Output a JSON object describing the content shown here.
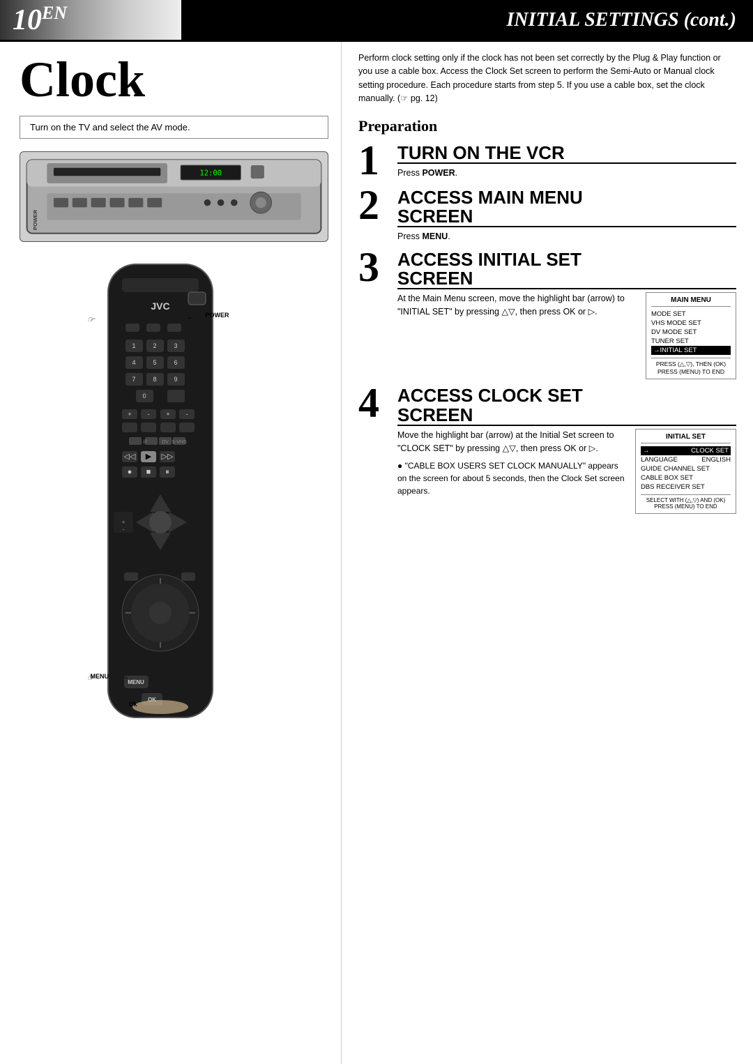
{
  "header": {
    "page_number": "10",
    "en_suffix": "EN",
    "title": "INITIAL SETTINGS (cont.)"
  },
  "left": {
    "section_title": "Clock",
    "tv_instruction": "Turn on the TV and select the AV mode.",
    "power_label": "POWER",
    "menu_label": "MENU",
    "ok_label": "Ok"
  },
  "right": {
    "intro": "Perform clock setting only if the clock has not been set correctly by the Plug & Play function or you use a cable box. Access the Clock Set screen to perform the Semi-Auto or Manual clock setting procedure. Each procedure starts from step 5. If you use a cable box, set the clock manually. (☞ pg. 12)",
    "preparation_title": "Preparation",
    "steps": [
      {
        "number": "1",
        "heading": "TURN ON THE VCR",
        "description": "Press ",
        "bold": "POWER",
        "description_after": "."
      },
      {
        "number": "2",
        "heading_line1": "ACCESS MAIN MENU",
        "heading_line2": "SCREEN",
        "description": "Press ",
        "bold": "MENU",
        "description_after": "."
      },
      {
        "number": "3",
        "heading_line1": "ACCESS INITIAL SET",
        "heading_line2": "SCREEN",
        "description": "At the Main Menu screen, move the highlight bar (arrow) to \"INITIAL SET\" by pressing △▽, then press OK or ▷."
      },
      {
        "number": "4",
        "heading_line1": "ACCESS CLOCK SET",
        "heading_line2": "SCREEN",
        "description": "Move the highlight bar (arrow) at the Initial Set screen to \"CLOCK SET\" by pressing △▽, then press OK or ▷.",
        "bullet": "\"CABLE BOX USERS SET CLOCK MANUALLY\" appears on the screen for about 5 seconds, then the Clock Set screen appears."
      }
    ],
    "main_menu_box": {
      "title": "MAIN MENU",
      "items": [
        "MODE SET",
        "VHS MODE SET",
        "DV MODE SET",
        "TUNER SET",
        "INITIAL SET"
      ],
      "highlighted_item": "INITIAL SET",
      "footer_line1": "PRESS (△,▽), THEN (OK)",
      "footer_line2": "PRESS (MENU) TO END"
    },
    "initial_set_box": {
      "title": "INITIAL SET",
      "items": [
        {
          "label": "CLOCK SET",
          "highlighted": true
        },
        {
          "label": "LANGUAGE",
          "value": "ENGLISH",
          "highlighted": false
        },
        {
          "label": "GUIDE CHANNEL SET",
          "highlighted": false
        },
        {
          "label": "CABLE BOX SET",
          "highlighted": false
        },
        {
          "label": "DBS RECEIVER SET",
          "highlighted": false
        }
      ],
      "footer_line1": "SELECT WITH (△,▽) AND (OK)",
      "footer_line2": "PRESS (MENU) TO END"
    }
  }
}
